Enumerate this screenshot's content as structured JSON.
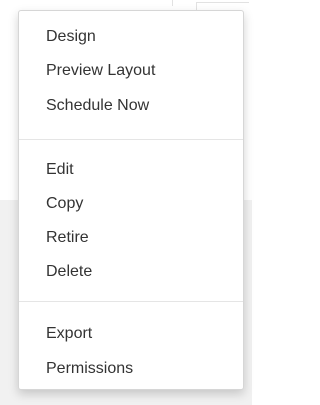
{
  "menu": {
    "groups": [
      {
        "items": [
          "Design",
          "Preview Layout",
          "Schedule Now"
        ]
      },
      {
        "items": [
          "Edit",
          "Copy",
          "Retire",
          "Delete"
        ]
      },
      {
        "items": [
          "Export",
          "Permissions"
        ]
      }
    ]
  }
}
